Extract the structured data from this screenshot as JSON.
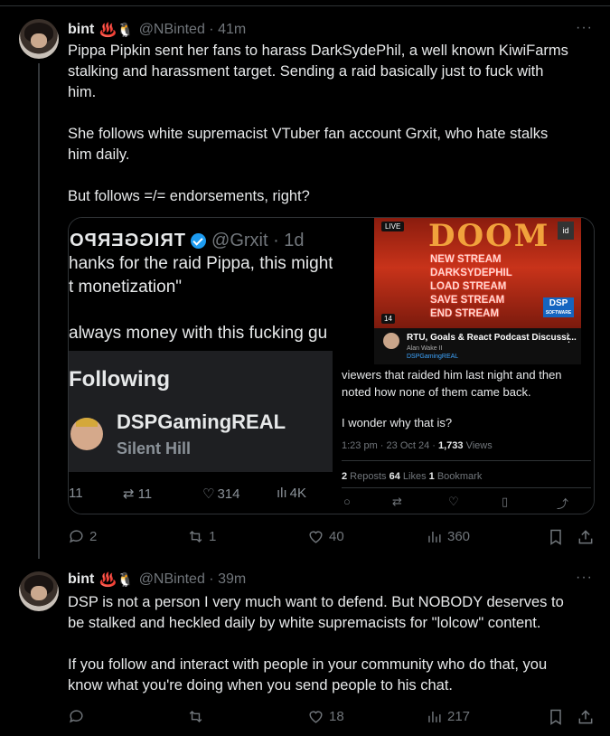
{
  "posts": [
    {
      "name": "bint",
      "emoji": "♨️🐧",
      "handle": "@NBinted · 41m",
      "text": "Pippa Pipkin sent her fans to harass DarkSydePhil, a well known KiwiFarms\nstalking and harassment target. Sending a raid basically just to fuck with\nhim.\n\nShe follows white supremacist VTuber fan account Grxit, who hate stalks\nhim daily.\n\nBut follows =/= endorsements, right?",
      "stats": {
        "replies": "2",
        "reposts": "1",
        "likes": "40",
        "views": "360"
      }
    },
    {
      "name": "bint",
      "emoji": "♨️🐧",
      "handle": "@NBinted · 39m",
      "text": "DSP is not a person I very much want to defend. But NOBODY deserves to\nbe stalked and heckled daily by white supremacists for \"lolcow\" content.\n\nIf you follow and interact with people in your community who do that, you\nknow what you're doing when you send people to his chat.",
      "stats": {
        "replies": "",
        "reposts": "",
        "likes": "18",
        "views": "217"
      }
    }
  ],
  "more_label": "···",
  "screenshot": {
    "left": {
      "author_mirrored": "TRIGGERPO",
      "handle": "@Grxit · 1d",
      "line1": "hanks for the raid Pippa, this might",
      "line2": "t monetization\"",
      "line3": "always money with this fucking gu",
      "follow_title": "Following",
      "follow_name": "DSPGamingREAL",
      "follow_sub": "Silent Hill",
      "stat_reply": "11",
      "stat_repost": "11",
      "stat_like": "314",
      "stat_views": "4K"
    },
    "right": {
      "thumb_title": "DOOM",
      "thumb_lines": [
        "NEW STREAM",
        "DARKSYDEPHIL",
        "LOAD STREAM",
        "SAVE STREAM",
        "END STREAM"
      ],
      "live": "LIVE",
      "duration": "14",
      "logo": "id",
      "dsp_badge": "DSP",
      "dsp_badge_sub": "SOFTWARE",
      "video_title": "RTU, Goals & React Podcast Discussi...",
      "video_sub": "Alan Wake II",
      "video_channel": "DSPGamingREAL",
      "text1": "viewers that raided him last night and then",
      "text2": "noted how none of them came back.",
      "text3": "I wonder why that is?",
      "time": "1:23 pm · 23 Oct 24 · ",
      "views_num": "1,733",
      "views_label": " Views",
      "reposts_num": "2",
      "reposts_label": " Reposts   ",
      "likes_num": "64",
      "likes_label": " Likes   ",
      "bookmarks_num": "1",
      "bookmarks_label": " Bookmark"
    }
  },
  "colors": {
    "background": "#000000",
    "text": "#e7e9ea",
    "muted": "#71767b",
    "border": "#2f3336",
    "verified": "#1d9bf0"
  }
}
